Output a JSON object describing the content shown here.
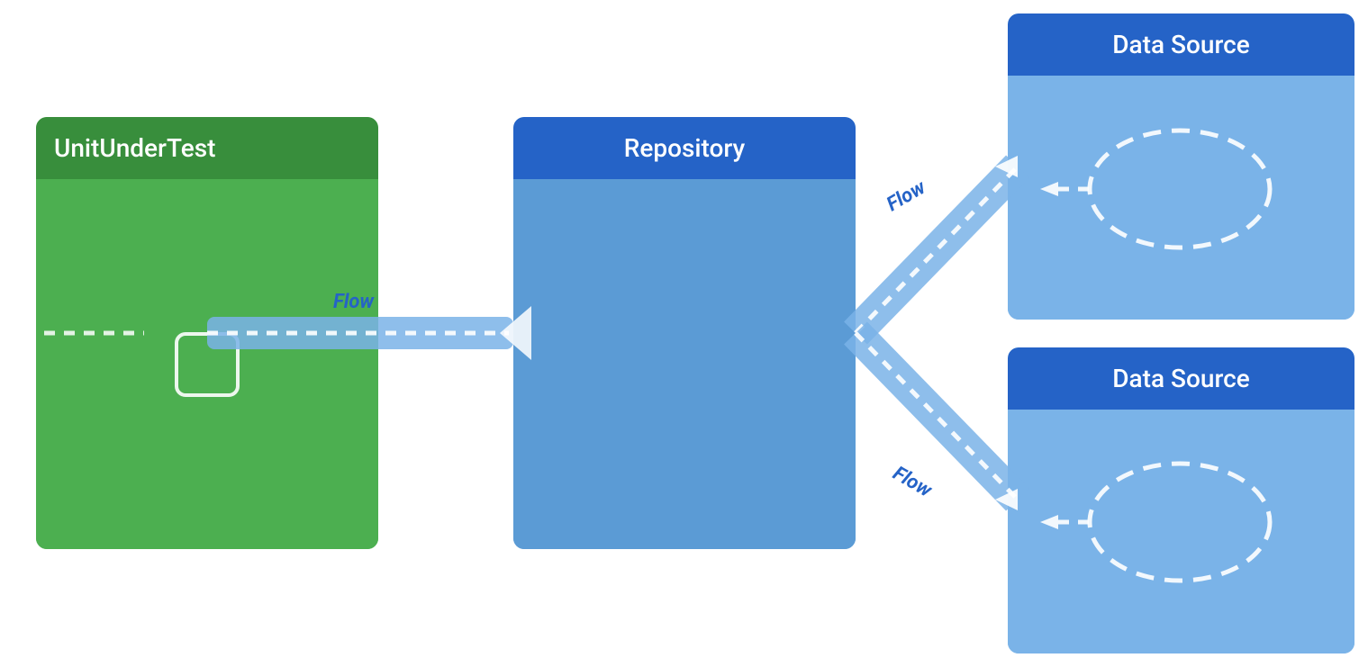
{
  "unit_under_test": {
    "header": "UnitUnderTest",
    "bg_header": "#388e3c",
    "bg_body": "#4caf50"
  },
  "repository": {
    "header": "Repository",
    "bg_header": "#2563c7",
    "bg_body": "#5b9bd5"
  },
  "data_source_top": {
    "header": "Data Source",
    "bg_header": "#2563c7",
    "bg_body": "#7ab3e8"
  },
  "data_source_bottom": {
    "header": "Data Source",
    "bg_header": "#2563c7",
    "bg_body": "#7ab3e8"
  },
  "flow_labels": {
    "unit_to_repo": "Flow",
    "repo_to_ds_top": "Flow",
    "repo_to_ds_bottom": "Flow"
  },
  "colors": {
    "dashed_line": "#ffffff",
    "flow_label": "#2563c7",
    "connector_bg": "#7ab3e8"
  }
}
